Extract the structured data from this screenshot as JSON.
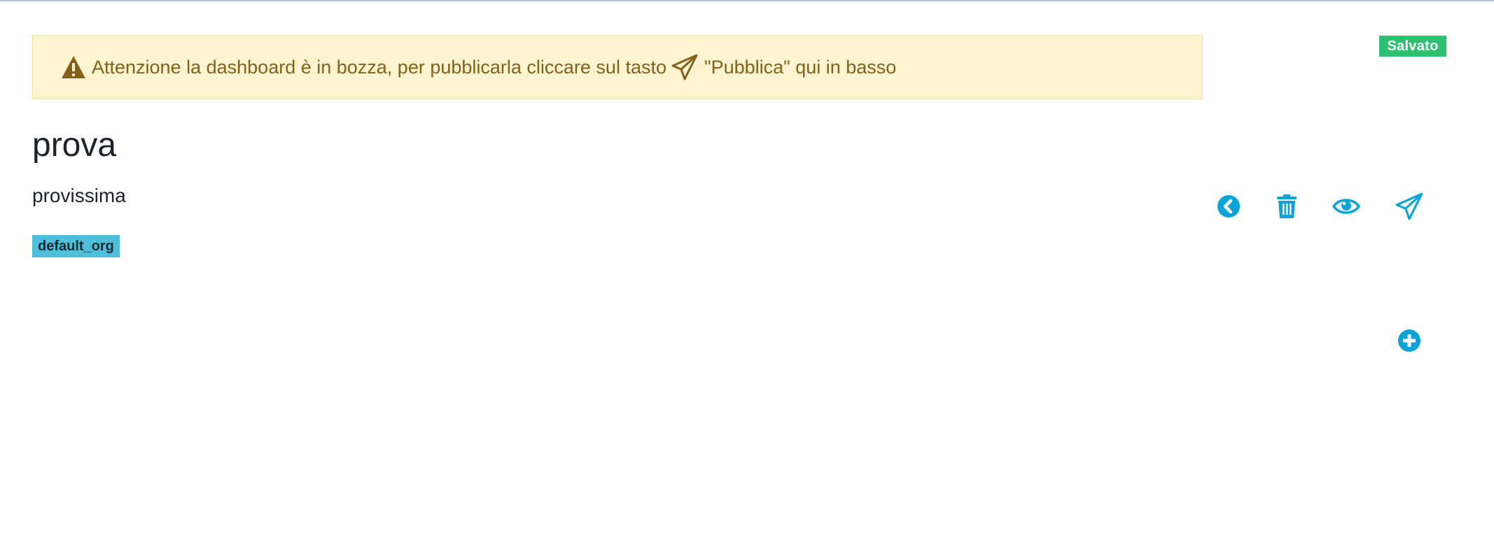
{
  "alert": {
    "text_before": "Attenzione la dashboard è in bozza, per pubblicarla cliccare sul tasto",
    "text_after": "\"Pubblica\" qui in basso",
    "icon_warning": "exclamation-triangle-icon",
    "icon_inline": "paper-plane-icon",
    "background": "#fff4d0",
    "text_color": "#84611a"
  },
  "status_badge": {
    "label": "Salvato",
    "color": "#2fbf71"
  },
  "dashboard": {
    "title": "prova",
    "description": "provissima",
    "organization": "default_org"
  },
  "actions": {
    "accent_color": "#0aa4d6",
    "buttons": [
      {
        "name": "back",
        "icon": "chevron-left-circle-icon"
      },
      {
        "name": "delete",
        "icon": "trash-icon"
      },
      {
        "name": "preview",
        "icon": "eye-icon"
      },
      {
        "name": "publish",
        "icon": "paper-plane-icon"
      }
    ],
    "add_widget": {
      "icon": "plus-circle-icon"
    }
  }
}
